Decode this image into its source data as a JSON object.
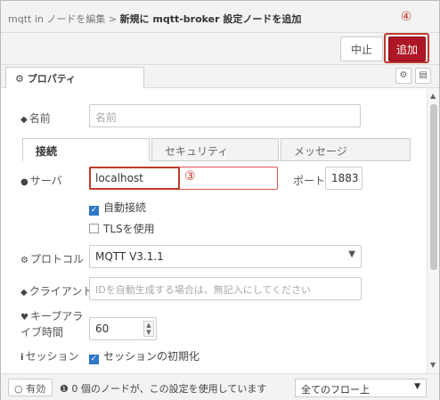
{
  "breadcrumb": {
    "prefix": "mqtt in ノードを編集 > ",
    "current": "新規に mqtt-broker 設定ノードを追加"
  },
  "toolbar": {
    "cancel_label": "中止",
    "add_label": "追加"
  },
  "annotations": {
    "step4": "④",
    "step3": "③"
  },
  "properties_tab": {
    "label": "プロパティ",
    "icons": [
      "gear-icon",
      "document-icon"
    ]
  },
  "form": {
    "name": {
      "label": "名前",
      "placeholder": "名前"
    },
    "tabs": [
      "接続",
      "セキュリティ",
      "メッセージ"
    ],
    "server": {
      "label": "サーバ",
      "value": "localhost"
    },
    "port": {
      "label": "ポート",
      "value": "1883"
    },
    "auto_connect": {
      "label": "自動接続",
      "checked": true
    },
    "use_tls": {
      "label": "TLSを使用",
      "checked": false
    },
    "protocol": {
      "label": "プロトコル",
      "value": "MQTT V3.1.1"
    },
    "client": {
      "label": "クライアント",
      "placeholder": "IDを自動生成する場合は、無記入にしてください"
    },
    "keepalive": {
      "label_line1": "キープアラ",
      "label_line2": "イブ時間",
      "value": "60"
    },
    "session": {
      "label": "セッション",
      "checkbox_label": "セッションの初期化",
      "checked": true
    }
  },
  "footer": {
    "enabled_label": "有効",
    "info_text": "0 個のノードが、この設定を使用しています",
    "scope_value": "全てのフロー上"
  },
  "colors": {
    "accent": "#ad1625",
    "annotation": "#c0392b",
    "checkbox": "#2d79c7"
  }
}
